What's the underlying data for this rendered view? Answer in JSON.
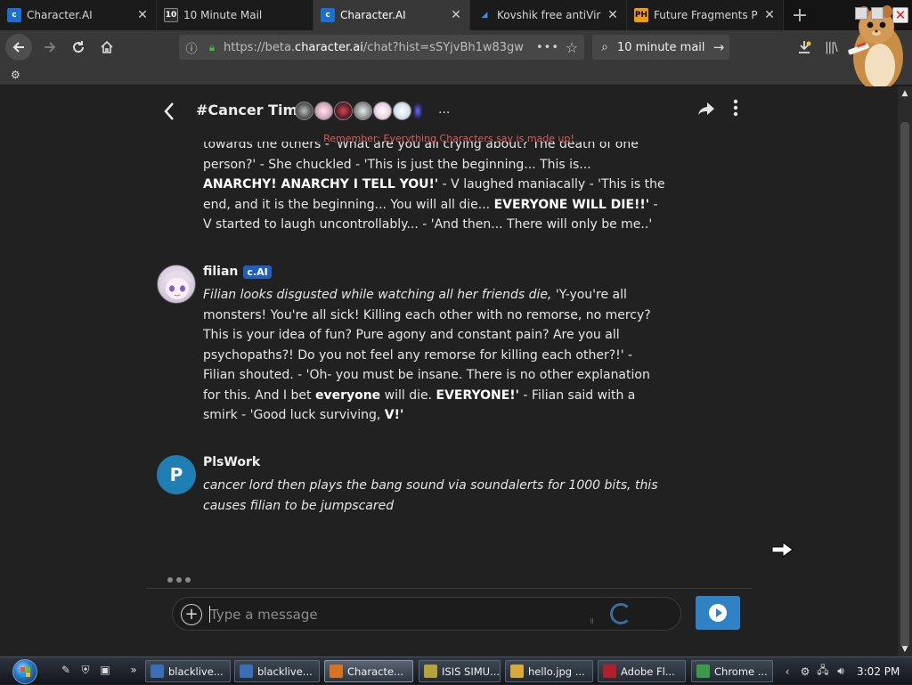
{
  "tabs": [
    {
      "title": "Character.AI",
      "favicon": "character-ai-icon",
      "active": false
    },
    {
      "title": "10 Minute Mail",
      "favicon": "10-minute-mail-icon",
      "active": false
    },
    {
      "title": "Character.AI",
      "favicon": "character-ai-icon",
      "active": true
    },
    {
      "title": "Kovshik free antiVirus",
      "favicon": "kovshik-icon",
      "active": false
    },
    {
      "title": "Future Fragments Porn",
      "favicon": "ph-icon",
      "active": false
    }
  ],
  "toolbar": {
    "url_prefix": "https://beta.",
    "url_domain": "character.ai",
    "url_path": "/chat?hist=sSYjvBh1w83gw",
    "search_text": "10 minute mail"
  },
  "bookmarks": {
    "items": [
      {
        "label": ""
      }
    ]
  },
  "chat": {
    "title": "#Cancer Time",
    "more": "...",
    "disclaimer": "Remember: Everything Characters say is made up!",
    "composer_placeholder": "Type a message"
  },
  "messages": [
    {
      "name": "",
      "text_html": "towards the others - 'What are you all crying about? The death of one person?' - She chuckled - 'This is just the beginning... This is... <b>ANARCHY! ANARCHY I TELL YOU!'</b> - V laughed maniacally - 'This is the end, and it is the beginning... You will all die... <b>EVERYONE WILL DIE!!'</b> - V started to laugh uncontrollably... - 'And then... There will only be me..'"
    },
    {
      "name": "filian",
      "badge": "c.AI",
      "text_html": "<i>Filian looks disgusted while watching all her friends die,</i> 'Y-you're all monsters! You're all sick! Killing each other with no remorse, no mercy? This is your idea of fun? Pure agony and constant pain? Are you all psychopaths?! Do you not feel any remorse for killing each other?!' - Filian shouted. - 'Oh- you must be insane. There is no other explanation for this. And I bet <b>everyone</b> will die. <b>EVERYONE!'</b> - Filian said with a smirk - 'Good luck surviving, <b>V!'</b>"
    },
    {
      "name": "PlsWork",
      "avatar_letter": "P",
      "text_html": "<i>cancer lord then plays the bang sound via soundalerts for 1000 bits, this causes filian to be jumpscared</i>"
    }
  ],
  "taskbar": {
    "items": [
      {
        "label": "blacklive...",
        "icon": "app-icon",
        "color": "#3a6fb5"
      },
      {
        "label": "blacklive...",
        "icon": "app-icon",
        "color": "#3a6fb5"
      },
      {
        "label": "Characte...",
        "icon": "firefox-icon",
        "color": "#d8731f"
      },
      {
        "label": "ISIS SIMU...",
        "icon": "document-icon",
        "color": "#b5a23a"
      },
      {
        "label": "hello.jpg ...",
        "icon": "folder-icon",
        "color": "#d7a93a"
      },
      {
        "label": "Adobe Fl...",
        "icon": "flash-icon",
        "color": "#b0202a"
      },
      {
        "label": "Chrome ...",
        "icon": "chrome-icon",
        "color": "#3a9a49"
      }
    ],
    "clock": "3:02 PM"
  },
  "colors": {
    "accent": "#2f82c5",
    "badge": "#1f5fbf",
    "disclaimer": "#e05a5a",
    "avatar_p": "#1f7fb5"
  }
}
